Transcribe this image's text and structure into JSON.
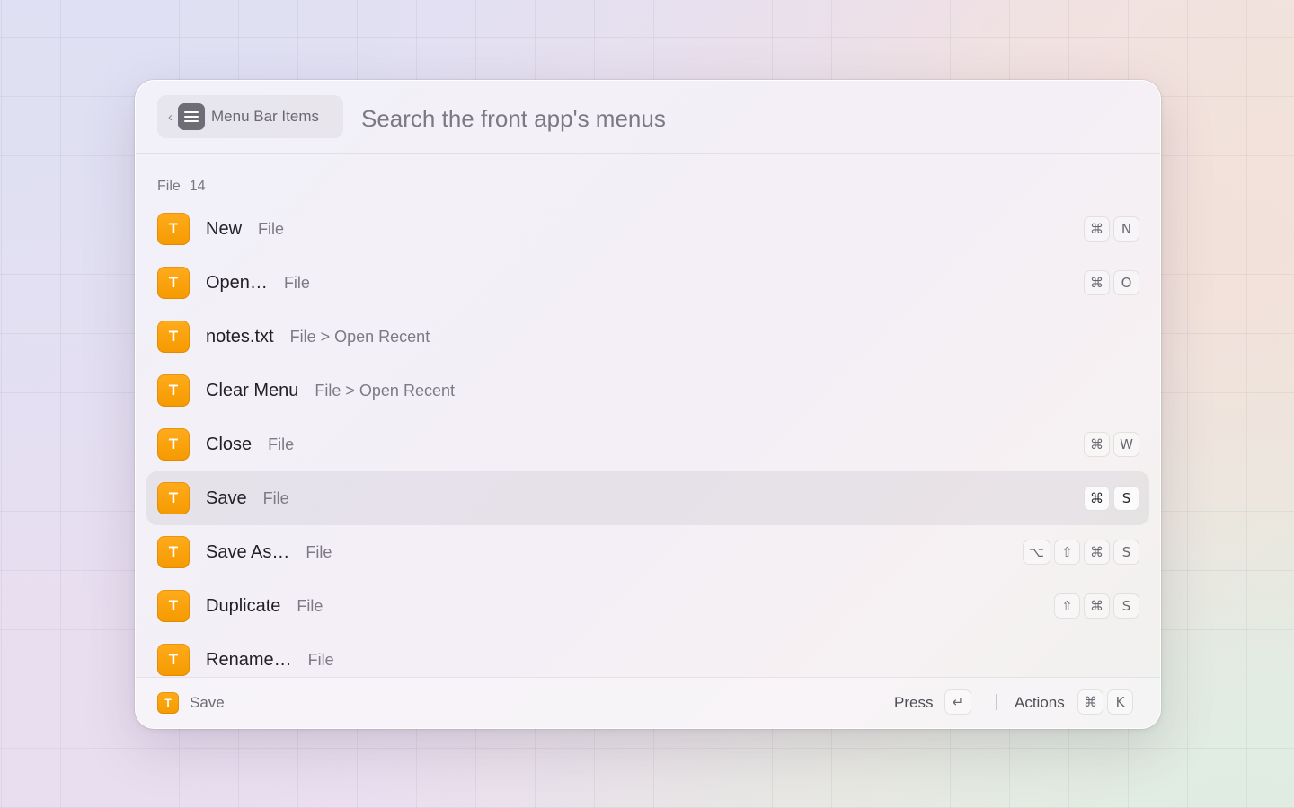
{
  "header": {
    "back_chevron": "‹",
    "breadcrumb_icon": "menu-lines-icon",
    "breadcrumb_label": "Menu Bar Items",
    "search_placeholder": "Search the front app's menus",
    "search_value": ""
  },
  "section": {
    "title": "File",
    "count": "14"
  },
  "items": [
    {
      "icon_letter": "T",
      "title": "New",
      "path": "File",
      "keys": [
        "⌘",
        "N"
      ],
      "selected": false
    },
    {
      "icon_letter": "T",
      "title": "Open…",
      "path": "File",
      "keys": [
        "⌘",
        "O"
      ],
      "selected": false
    },
    {
      "icon_letter": "T",
      "title": "notes.txt",
      "path": "File > Open Recent",
      "keys": [],
      "selected": false
    },
    {
      "icon_letter": "T",
      "title": "Clear Menu",
      "path": "File > Open Recent",
      "keys": [],
      "selected": false
    },
    {
      "icon_letter": "T",
      "title": "Close",
      "path": "File",
      "keys": [
        "⌘",
        "W"
      ],
      "selected": false
    },
    {
      "icon_letter": "T",
      "title": "Save",
      "path": "File",
      "keys": [
        "⌘",
        "S"
      ],
      "selected": true
    },
    {
      "icon_letter": "T",
      "title": "Save As…",
      "path": "File",
      "keys": [
        "⌥",
        "⇧",
        "⌘",
        "S"
      ],
      "selected": false
    },
    {
      "icon_letter": "T",
      "title": "Duplicate",
      "path": "File",
      "keys": [
        "⇧",
        "⌘",
        "S"
      ],
      "selected": false
    },
    {
      "icon_letter": "T",
      "title": "Rename…",
      "path": "File",
      "keys": [],
      "selected": false
    }
  ],
  "footer": {
    "app_icon_letter": "T",
    "selected_name": "Save",
    "press_label": "Press",
    "enter_key": "↵",
    "actions_label": "Actions",
    "actions_keys": [
      "⌘",
      "K"
    ]
  },
  "colors": {
    "accent_icon": "#f59a00",
    "selected_row_bg": "#e6e2ea"
  }
}
